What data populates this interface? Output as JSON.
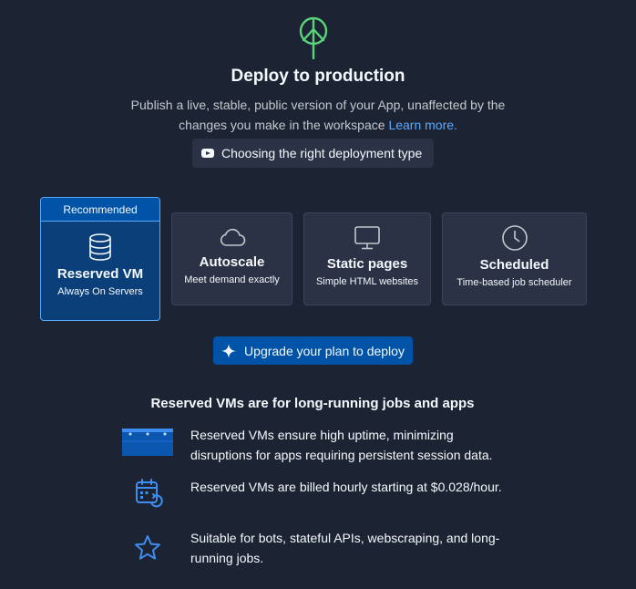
{
  "header": {
    "title": "Deploy to production",
    "subtitle": "Publish a live, stable, public version of your App, unaffected by the changes you make in the workspace",
    "learn_more": "Learn more.",
    "guide_button": "Choosing the right deployment type",
    "icon": "antenna-broadcast-icon"
  },
  "deployment_types": {
    "recommended_label": "Recommended",
    "items": [
      {
        "name": "Reserved VM",
        "description": "Always On Servers",
        "icon": "database-icon",
        "selected": true
      },
      {
        "name": "Autoscale",
        "description": "Meet demand exactly",
        "icon": "cloud-icon",
        "selected": false
      },
      {
        "name": "Static pages",
        "description": "Simple HTML websites",
        "icon": "monitor-icon",
        "selected": false
      },
      {
        "name": "Scheduled",
        "description": "Time-based job scheduler",
        "icon": "clock-icon",
        "selected": false
      }
    ]
  },
  "upgrade_button": "Upgrade your plan to deploy",
  "info": {
    "heading": "Reserved VMs are for long-running jobs and apps",
    "items": [
      {
        "text": "Reserved VMs ensure high uptime, minimizing disruptions for apps requiring persistent session data.",
        "icon": "server-rack-icon"
      },
      {
        "text": "Reserved VMs are billed hourly starting at $0.028/hour.",
        "icon": "calendar-refresh-icon"
      },
      {
        "text": "Suitable for bots, stateful APIs, webscraping, and long-running jobs.",
        "icon": "star-icon"
      }
    ]
  },
  "colors": {
    "background": "#1c2333",
    "surface": "#2b3245",
    "accent": "#0053a6",
    "accent_light": "#57abff",
    "green": "#5bd37a"
  }
}
